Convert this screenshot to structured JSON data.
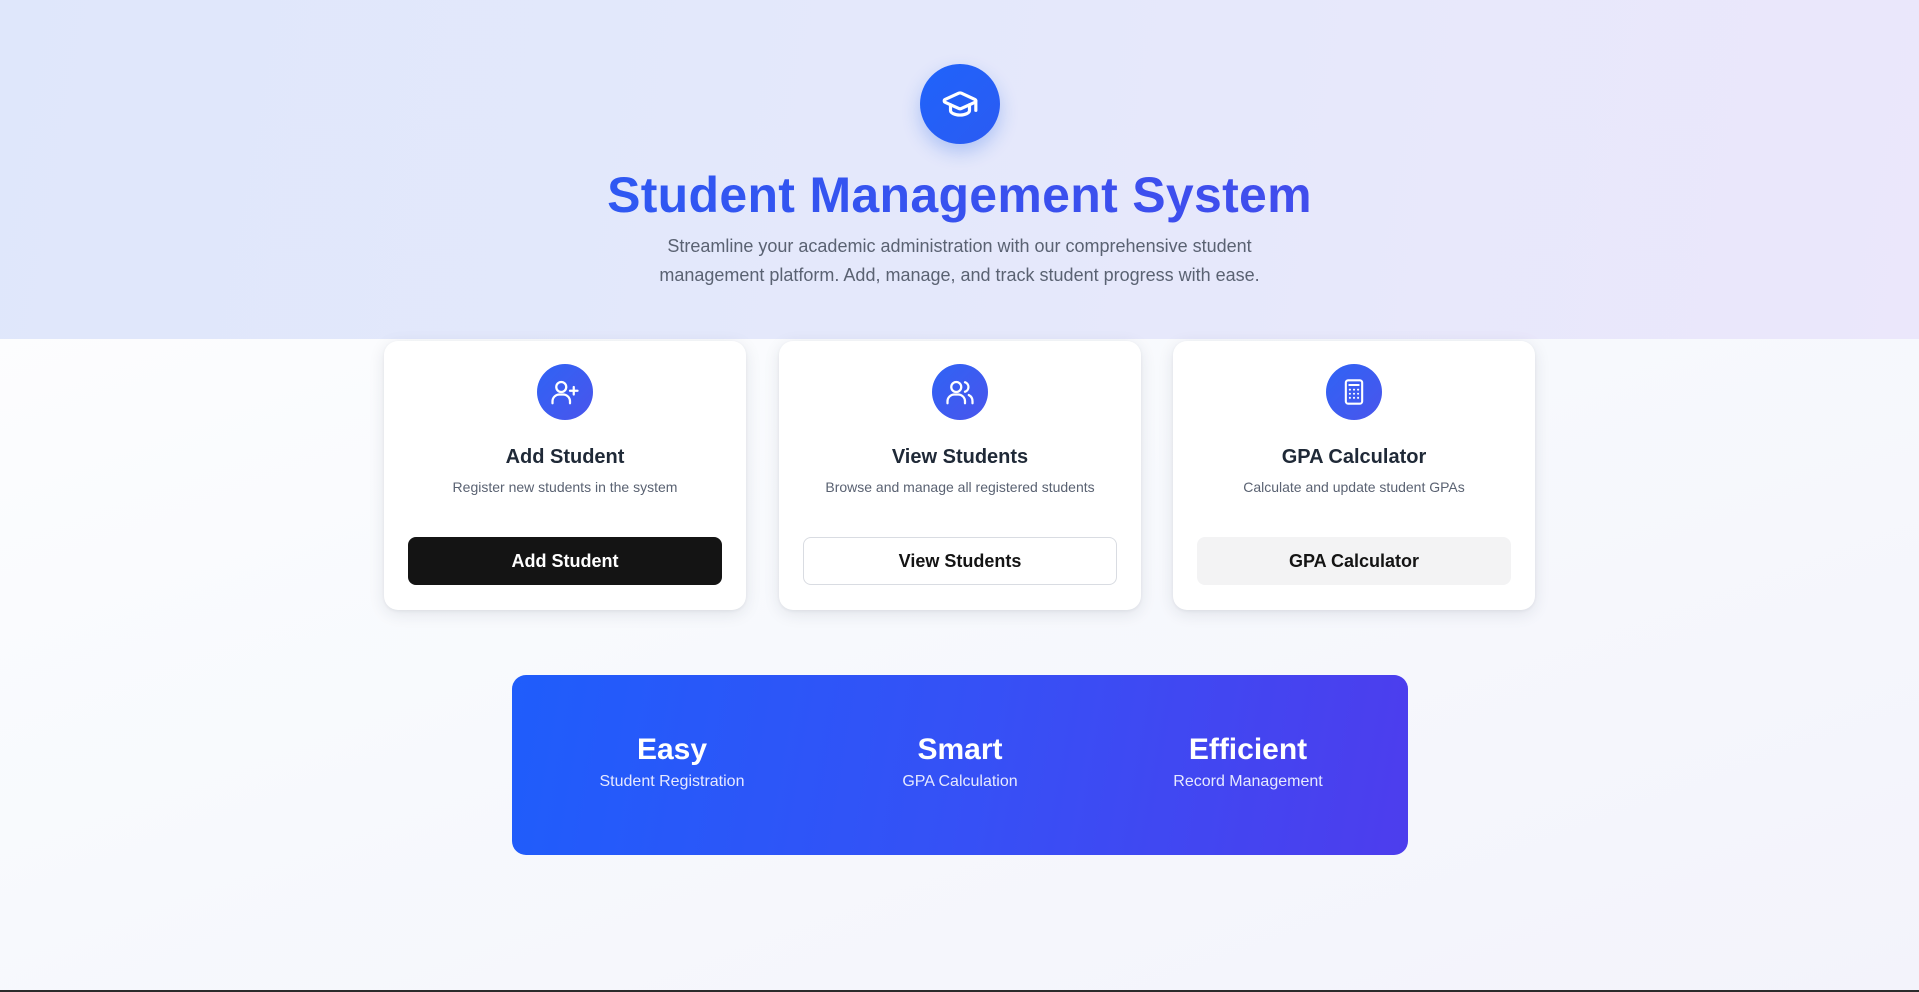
{
  "hero": {
    "icon": "graduation-cap-icon",
    "title": "Student Management System",
    "subtitle": "Streamline your academic administration with our comprehensive student management platform. Add, manage, and track student progress with ease."
  },
  "cards": [
    {
      "icon": "user-plus-icon",
      "title": "Add Student",
      "description": "Register new students in the system",
      "button_label": "Add Student",
      "button_style": "dark"
    },
    {
      "icon": "users-icon",
      "title": "View Students",
      "description": "Browse and manage all registered students",
      "button_label": "View Students",
      "button_style": "outline"
    },
    {
      "icon": "calculator-icon",
      "title": "GPA Calculator",
      "description": "Calculate and update student GPAs",
      "button_label": "GPA Calculator",
      "button_style": "light"
    }
  ],
  "stats": [
    {
      "value": "Easy",
      "label": "Student Registration"
    },
    {
      "value": "Smart",
      "label": "GPA Calculation"
    },
    {
      "value": "Efficient",
      "label": "Record Management"
    }
  ],
  "colors": {
    "accent": "#1f63fb",
    "accent_purple": "#4d3ded",
    "dark_button": "#141414",
    "hero_background": "#e3e8fb"
  }
}
